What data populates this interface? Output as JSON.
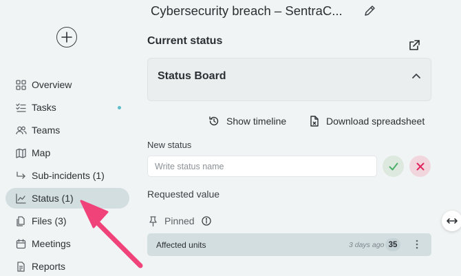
{
  "incident": {
    "title": "Cybersecurity breach – SentraC..."
  },
  "sidebar": {
    "items": [
      {
        "label": "Overview",
        "icon": "grid-icon"
      },
      {
        "label": "Tasks",
        "icon": "checklist-icon",
        "unread_dot": true
      },
      {
        "label": "Teams",
        "icon": "people-icon"
      },
      {
        "label": "Map",
        "icon": "map-icon"
      },
      {
        "label": "Sub-incidents (1)",
        "icon": "sub-incident-arrow-icon"
      },
      {
        "label": "Status (1)",
        "icon": "line-chart-icon",
        "active": true
      },
      {
        "label": "Files (3)",
        "icon": "files-icon"
      },
      {
        "label": "Meetings",
        "icon": "calendar-icon"
      },
      {
        "label": "Reports",
        "icon": "report-icon"
      }
    ]
  },
  "main": {
    "section_title": "Current status",
    "board_title": "Status Board",
    "actions": {
      "timeline": "Show timeline",
      "spreadsheet": "Download spreadsheet"
    },
    "new_status": {
      "label": "New status",
      "placeholder": "Write status name",
      "value": ""
    },
    "requested_value_label": "Requested value",
    "pinned_label": "Pinned",
    "rows": [
      {
        "label": "Affected units",
        "time": "3 days ago",
        "count": "35"
      }
    ]
  },
  "colors": {
    "background": "#f1f4f4",
    "active_nav": "#d3dee1",
    "confirm": "#4caf6a",
    "cancel": "#e0245e",
    "annotation_arrow": "#f0437a",
    "unread_dot": "#5bbec9"
  }
}
